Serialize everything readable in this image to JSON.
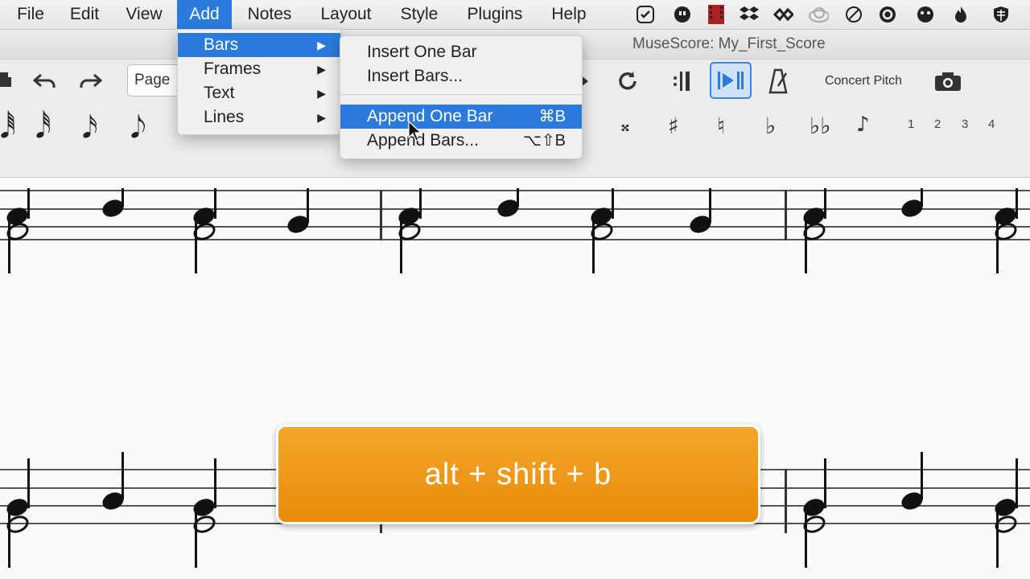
{
  "menubar": {
    "items": [
      "File",
      "Edit",
      "View",
      "Add",
      "Notes",
      "Layout",
      "Style",
      "Plugins",
      "Help"
    ],
    "active": "Add"
  },
  "window": {
    "title": "MuseScore: My_First_Score"
  },
  "toolbar": {
    "page_view_value": "Page",
    "concert_pitch_label": "Concert Pitch"
  },
  "palette": {
    "voice_numbers": [
      "1",
      "2",
      "3",
      "4"
    ]
  },
  "add_menu": {
    "items": [
      {
        "label": "Bars",
        "highlighted": true
      },
      {
        "label": "Frames"
      },
      {
        "label": "Text"
      },
      {
        "label": "Lines"
      }
    ]
  },
  "bars_submenu": {
    "items": [
      {
        "label": "Insert One Bar",
        "shortcut": ""
      },
      {
        "label": "Insert Bars...",
        "shortcut": ""
      },
      {
        "label": "Append One Bar",
        "shortcut": "⌘B",
        "highlighted": true
      },
      {
        "label": "Append Bars...",
        "shortcut": "⌥⇧B"
      }
    ]
  },
  "shortcut_banner": {
    "text": "alt + shift + b"
  },
  "colors": {
    "highlight": "#2a7bdc",
    "banner": "#f0a020"
  }
}
